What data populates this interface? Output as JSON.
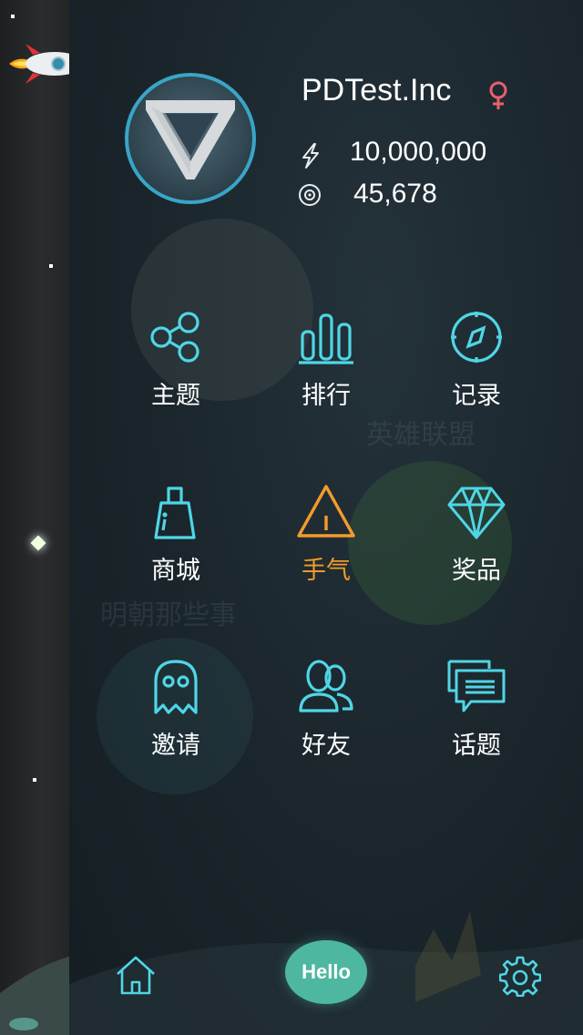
{
  "profile": {
    "name": "PDTest.Inc",
    "gender_icon": "female-icon",
    "energy": "10,000,000",
    "coins": "45,678"
  },
  "menu": [
    {
      "id": "theme",
      "label": "主题",
      "icon": "share-nodes-icon"
    },
    {
      "id": "rank",
      "label": "排行",
      "icon": "bar-chart-icon"
    },
    {
      "id": "record",
      "label": "记录",
      "icon": "compass-icon"
    },
    {
      "id": "shop",
      "label": "商城",
      "icon": "shopping-bag-icon"
    },
    {
      "id": "luck",
      "label": "手气",
      "icon": "warning-triangle-icon"
    },
    {
      "id": "prize",
      "label": "奖品",
      "icon": "diamond-icon"
    },
    {
      "id": "invite",
      "label": "邀请",
      "icon": "ghost-icon"
    },
    {
      "id": "friends",
      "label": "好友",
      "icon": "users-icon"
    },
    {
      "id": "topics",
      "label": "话题",
      "icon": "chat-bubbles-icon"
    }
  ],
  "background_text": [
    "英雄联盟",
    "明朝那些事"
  ],
  "bottom_bar": {
    "hello_label": "Hello",
    "home_icon": "home-icon",
    "settings_icon": "gear-icon"
  },
  "colors": {
    "accent_cyan": "#4fd6e6",
    "highlight_orange": "#f39b2a",
    "female_pink": "#e8606e",
    "hello_green": "#4db89f"
  }
}
